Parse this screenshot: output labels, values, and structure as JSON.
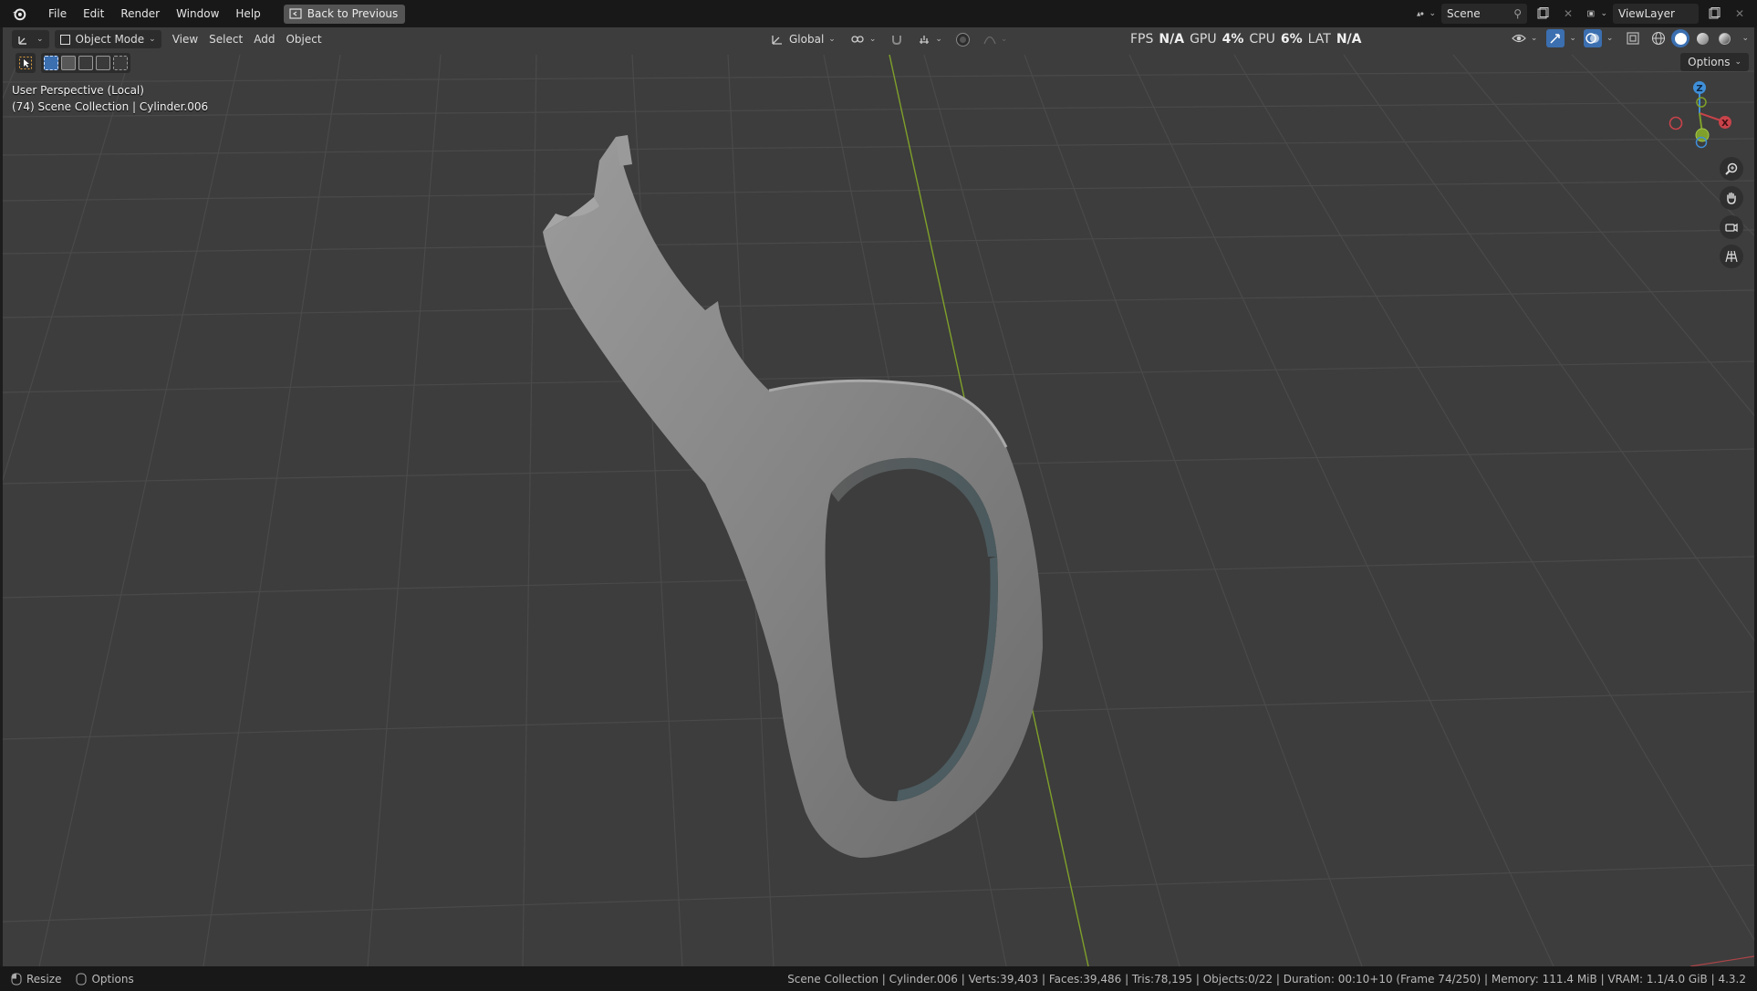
{
  "menu": {
    "items": [
      "File",
      "Edit",
      "Render",
      "Window",
      "Help"
    ],
    "back_button": "Back to Previous"
  },
  "top_right": {
    "scene": "Scene",
    "view_layer": "ViewLayer"
  },
  "viewport_header": {
    "mode": "Object Mode",
    "menus": [
      "View",
      "Select",
      "Add",
      "Object"
    ],
    "transform_orientation": "Global",
    "options": "Options"
  },
  "stats": {
    "fps_label": "FPS",
    "fps_value": "N/A",
    "gpu_label": "GPU",
    "gpu_value": "4%",
    "cpu_label": "CPU",
    "cpu_value": "6%",
    "lat_label": "LAT",
    "lat_value": "N/A"
  },
  "viewport_info": {
    "view_name": "User Perspective (Local)",
    "collection": "(74) Scene Collection | Cylinder.006"
  },
  "gizmo": {
    "x": "X",
    "z": "Z"
  },
  "statusbar": {
    "left": [
      "Resize",
      "Options"
    ],
    "right": "Scene Collection | Cylinder.006 | Verts:39,403 | Faces:39,486 | Tris:78,195 | Objects:0/22 | Duration: 00:10+10 (Frame 74/250) | Memory: 111.4 MiB | VRAM: 1.1/4.0 GiB | 4.3.2"
  },
  "colors": {
    "viewport_bg": "#3d3d3d",
    "grid_line": "#4a4a4a",
    "y_axis": "#7fa02a",
    "x_axis": "#c8434a",
    "z_axis": "#3f8fd8",
    "mesh": "#8a8a8a"
  }
}
